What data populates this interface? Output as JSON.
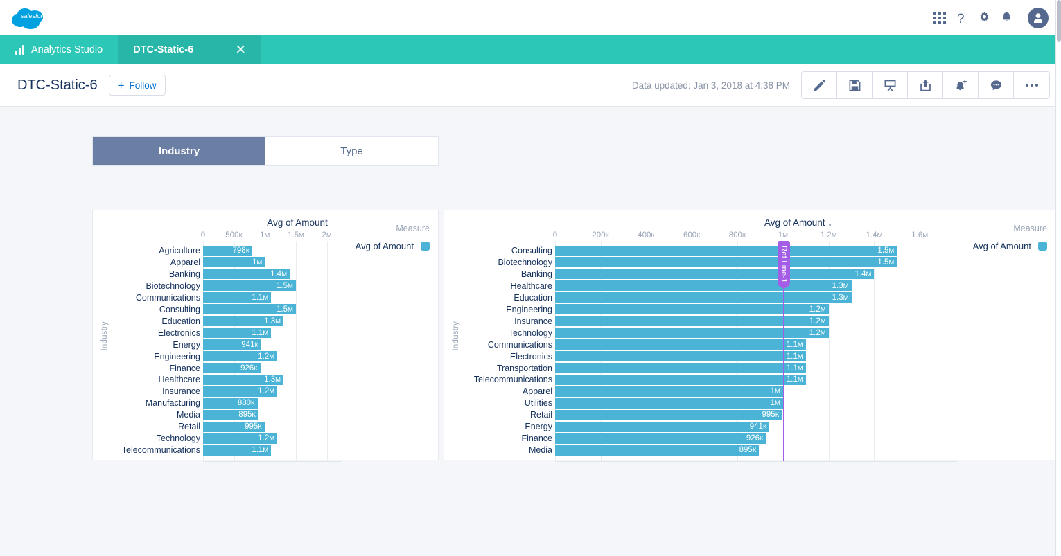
{
  "header": {
    "logo_text": "salesforce",
    "icons": [
      {
        "name": "app-launcher-icon",
        "label": "App Launcher"
      },
      {
        "name": "help-icon",
        "label": "Help"
      },
      {
        "name": "gear-icon",
        "label": "Setup"
      },
      {
        "name": "bell-icon",
        "label": "Notifications"
      },
      {
        "name": "avatar",
        "label": "User"
      }
    ]
  },
  "tabstrip": {
    "studio_label": "Analytics Studio",
    "studio_icon": "bar-chart-icon",
    "document_label": "DTC-Static-6",
    "close_label": "✕"
  },
  "page": {
    "title": "DTC-Static-6",
    "follow_label": "Follow",
    "follow_plus": "+",
    "data_updated": "Data updated: Jan 3, 2018 at 4:38 PM",
    "toolbar": [
      {
        "name": "edit-button",
        "icon": "pencil-icon"
      },
      {
        "name": "save-button",
        "icon": "floppy-disk-icon"
      },
      {
        "name": "present-button",
        "icon": "presentation-icon"
      },
      {
        "name": "share-button",
        "icon": "share-icon"
      },
      {
        "name": "subscribe-button",
        "icon": "bell-plus-icon"
      },
      {
        "name": "chatter-button",
        "icon": "chat-bubble-icon"
      },
      {
        "name": "more-button",
        "icon": "ellipsis-icon"
      }
    ]
  },
  "toggle_tabs": {
    "items": [
      {
        "label": "Industry",
        "active": true
      },
      {
        "label": "Type",
        "active": false
      }
    ]
  },
  "legend": {
    "measure_label": "Measure",
    "series_label": "Avg of Amount",
    "swatch_color": "#4BB4D6"
  },
  "colors": {
    "bar": "#4BB4D6",
    "teal_tabstrip": "#2DC7B8",
    "teal_tab_active": "#27B6A8",
    "toggle_active": "#6B7FA5",
    "refline": "#A45EE5",
    "page_bg": "#F4F6F9",
    "link_blue": "#0070D2"
  },
  "chart_data": [
    {
      "id": "left-chart",
      "type": "bar",
      "orientation": "horizontal",
      "title": "Avg of Amount",
      "xlabel": "Avg of Amount",
      "ylabel": "Industry",
      "sorted": false,
      "grid": true,
      "legend_position": "right",
      "xlim": [
        0,
        2150000
      ],
      "xticks": [
        0,
        500000,
        1000000,
        1500000,
        2000000
      ],
      "xticklabels": [
        "0",
        "500к",
        "1м",
        "1.5м",
        "2м"
      ],
      "categories": [
        "Agriculture",
        "Apparel",
        "Banking",
        "Biotechnology",
        "Communications",
        "Consulting",
        "Education",
        "Electronics",
        "Energy",
        "Engineering",
        "Finance",
        "Healthcare",
        "Insurance",
        "Manufacturing",
        "Media",
        "Retail",
        "Technology",
        "Telecommunications"
      ],
      "values": [
        798000,
        1000000,
        1400000,
        1500000,
        1100000,
        1500000,
        1300000,
        1100000,
        941000,
        1200000,
        926000,
        1300000,
        1200000,
        880000,
        895000,
        995000,
        1200000,
        1100000
      ],
      "datalabels": [
        "798к",
        "1м",
        "1.4м",
        "1.5м",
        "1.1м",
        "1.5м",
        "1.3м",
        "1.1м",
        "941к",
        "1.2м",
        "926к",
        "1.3м",
        "1.2м",
        "880к",
        "895к",
        "995к",
        "1.2м",
        "1.1м"
      ]
    },
    {
      "id": "right-chart",
      "type": "bar",
      "orientation": "horizontal",
      "title": "Avg of Amount ↓",
      "xlabel": "Avg of Amount",
      "ylabel": "Industry",
      "sorted": true,
      "sort_direction": "descending",
      "grid": true,
      "legend_position": "right",
      "xlim": [
        0,
        1730000
      ],
      "xticks": [
        0,
        200000,
        400000,
        600000,
        800000,
        1000000,
        1200000,
        1400000,
        1600000
      ],
      "xticklabels": [
        "0",
        "200к",
        "400к",
        "600к",
        "800к",
        "1м",
        "1.2м",
        "1.4м",
        "1.6м"
      ],
      "reference_line": {
        "label": "Ref Line-1",
        "value": 1000000,
        "color": "#A45EE5"
      },
      "categories": [
        "Consulting",
        "Biotechnology",
        "Banking",
        "Healthcare",
        "Education",
        "Engineering",
        "Insurance",
        "Technology",
        "Communications",
        "Electronics",
        "Transportation",
        "Telecommunications",
        "Apparel",
        "Utilities",
        "Retail",
        "Energy",
        "Finance",
        "Media"
      ],
      "values": [
        1500000,
        1500000,
        1400000,
        1300000,
        1300000,
        1200000,
        1200000,
        1200000,
        1100000,
        1100000,
        1100000,
        1100000,
        1000000,
        1000000,
        995000,
        941000,
        926000,
        895000
      ],
      "datalabels": [
        "1.5м",
        "1.5м",
        "1.4м",
        "1.3м",
        "1.3м",
        "1.2м",
        "1.2м",
        "1.2м",
        "1.1м",
        "1.1м",
        "1.1м",
        "1.1м",
        "1м",
        "1м",
        "995к",
        "941к",
        "926к",
        "895к"
      ]
    }
  ]
}
